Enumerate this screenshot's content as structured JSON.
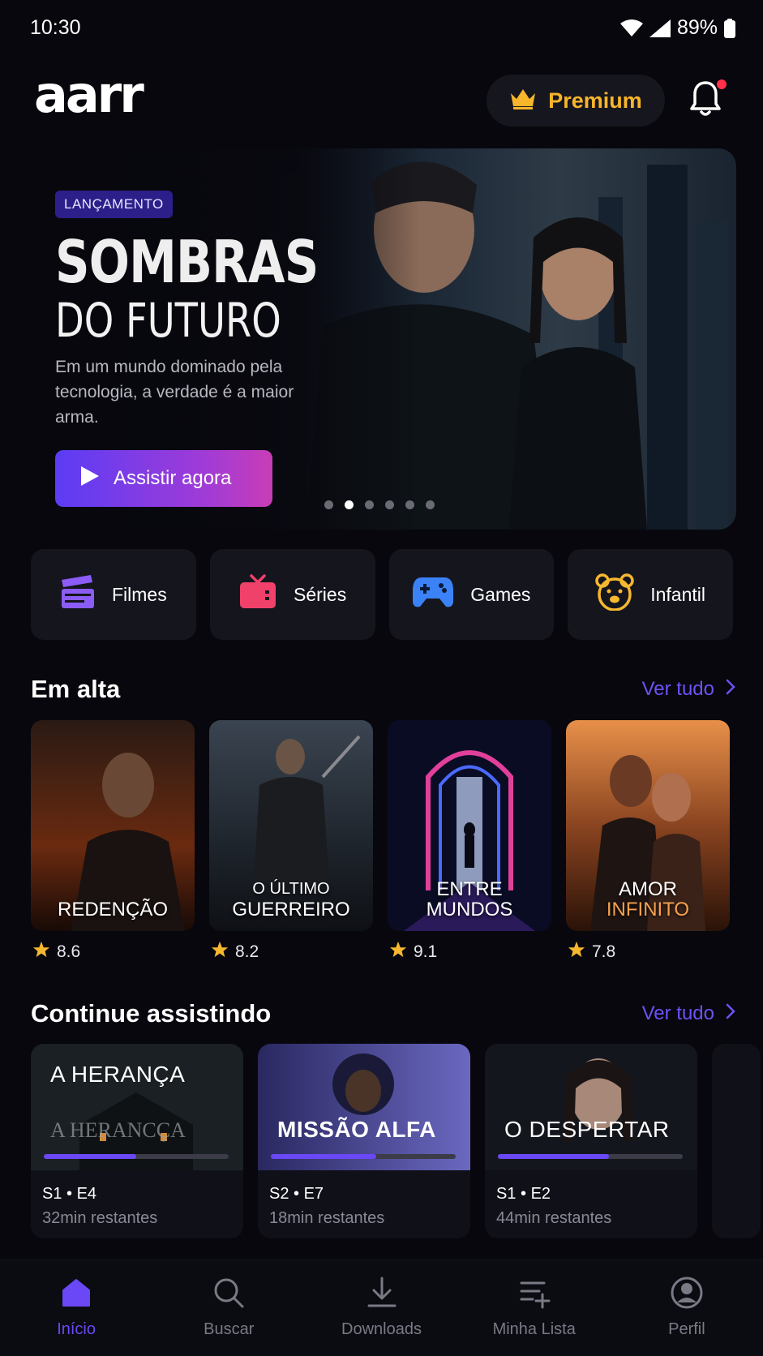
{
  "status_bar": {
    "time": "10:30",
    "battery": "89%"
  },
  "header": {
    "logo": "aarr",
    "premium_label": "Premium",
    "notification_unread": true
  },
  "hero": {
    "badge": "LANÇAMENTO",
    "title_line1": "SOMBRAS",
    "title_line2": "DO FUTURO",
    "description": "Em um mundo dominado pela tecnologia, a verdade é a maior arma.",
    "cta_label": "Assistir agora",
    "carousel_count": 6,
    "carousel_active": 1
  },
  "categories": [
    {
      "label": "Filmes",
      "icon": "clapperboard-icon",
      "color": "#8b5cf6"
    },
    {
      "label": "Séries",
      "icon": "tv-icon",
      "color": "#f0416b"
    },
    {
      "label": "Games",
      "icon": "gamepad-icon",
      "color": "#3b82f6"
    },
    {
      "label": "Infantil",
      "icon": "bear-icon",
      "color": "#f5b82e"
    }
  ],
  "trending": {
    "title": "Em alta",
    "see_all": "Ver tudo",
    "items": [
      {
        "title_main": "REDENÇÃO",
        "title_small": "",
        "title_accent": "",
        "rating": "8.6"
      },
      {
        "title_main": "GUERREIRO",
        "title_small": "O ÚLTIMO",
        "title_accent": "",
        "rating": "8.2"
      },
      {
        "title_main": "ENTRE",
        "title_small": "",
        "title_accent": "",
        "title_line2": "MUNDOS",
        "rating": "9.1"
      },
      {
        "title_main": "AMOR",
        "title_small": "",
        "title_accent": "INFINITO",
        "rating": "7.8"
      }
    ]
  },
  "continue_watching": {
    "title": "Continue assistindo",
    "see_all": "Ver tudo",
    "items": [
      {
        "title": "A HERANÇA",
        "subtitle": "A HERANCÇA",
        "episode": "S1 • E4",
        "remaining": "32min restantes",
        "progress": 0.5
      },
      {
        "title": "MISSÃO ALFA",
        "episode": "S2 • E7",
        "remaining": "18min restantes",
        "progress": 0.57
      },
      {
        "title": "O DESPERTAR",
        "episode": "S1 • E2",
        "remaining": "44min restantes",
        "progress": 0.6
      }
    ]
  },
  "bottom_nav": [
    {
      "label": "Início",
      "icon": "home-icon",
      "active": true
    },
    {
      "label": "Buscar",
      "icon": "search-icon",
      "active": false
    },
    {
      "label": "Downloads",
      "icon": "download-icon",
      "active": false
    },
    {
      "label": "Minha Lista",
      "icon": "playlist-add-icon",
      "active": false
    },
    {
      "label": "Perfil",
      "icon": "profile-icon",
      "active": false
    }
  ],
  "colors": {
    "accent": "#6a48f5",
    "premium": "#f7b52b",
    "background": "#07070d"
  }
}
